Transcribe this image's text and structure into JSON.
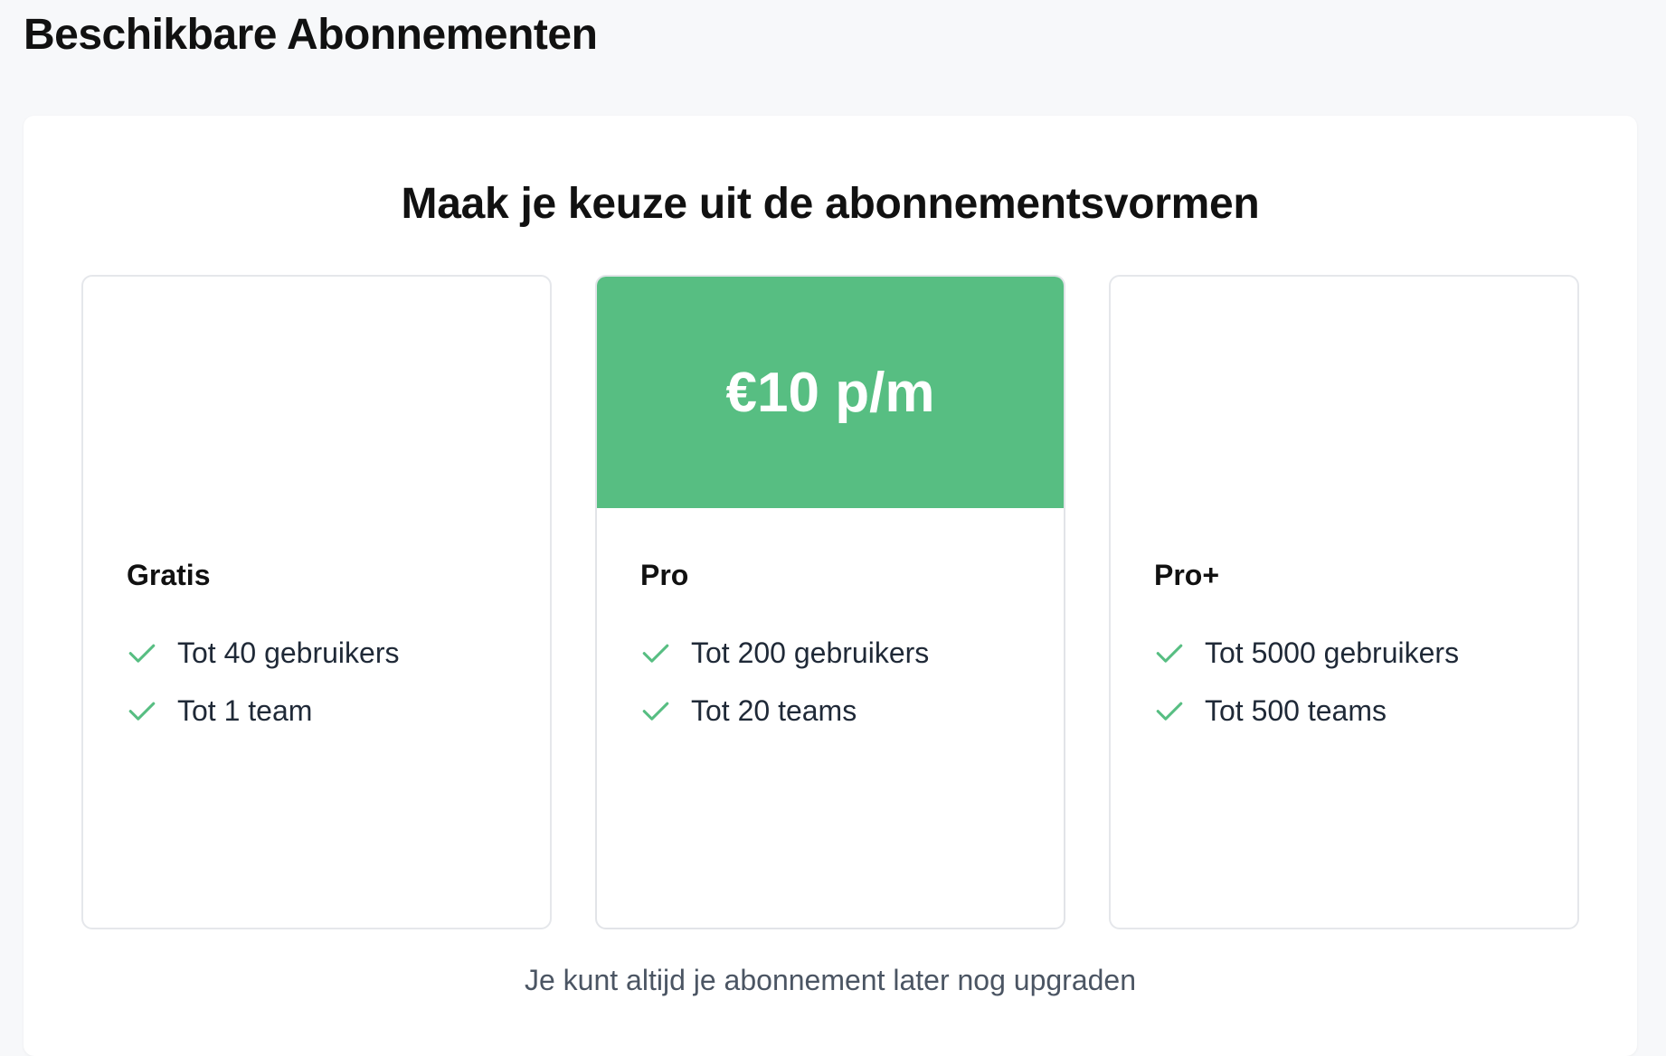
{
  "header": {
    "title": "Beschikbare Abonnementen"
  },
  "panel": {
    "heading": "Maak je keuze uit de abonnementsvormen",
    "footnote": "Je kunt altijd je abonnement later nog upgraden"
  },
  "colors": {
    "accent": "#57be82",
    "check": "#57be82"
  },
  "plans": [
    {
      "name": "Gratis",
      "price": "",
      "features": [
        "Tot 40 gebruikers",
        "Tot 1 team"
      ]
    },
    {
      "name": "Pro",
      "price": "€10 p/m",
      "features": [
        "Tot 200 gebruikers",
        "Tot 20 teams"
      ]
    },
    {
      "name": "Pro+",
      "price": "",
      "features": [
        "Tot 5000 gebruikers",
        "Tot 500 teams"
      ]
    }
  ],
  "icons": {
    "feature_check": "check-icon"
  }
}
